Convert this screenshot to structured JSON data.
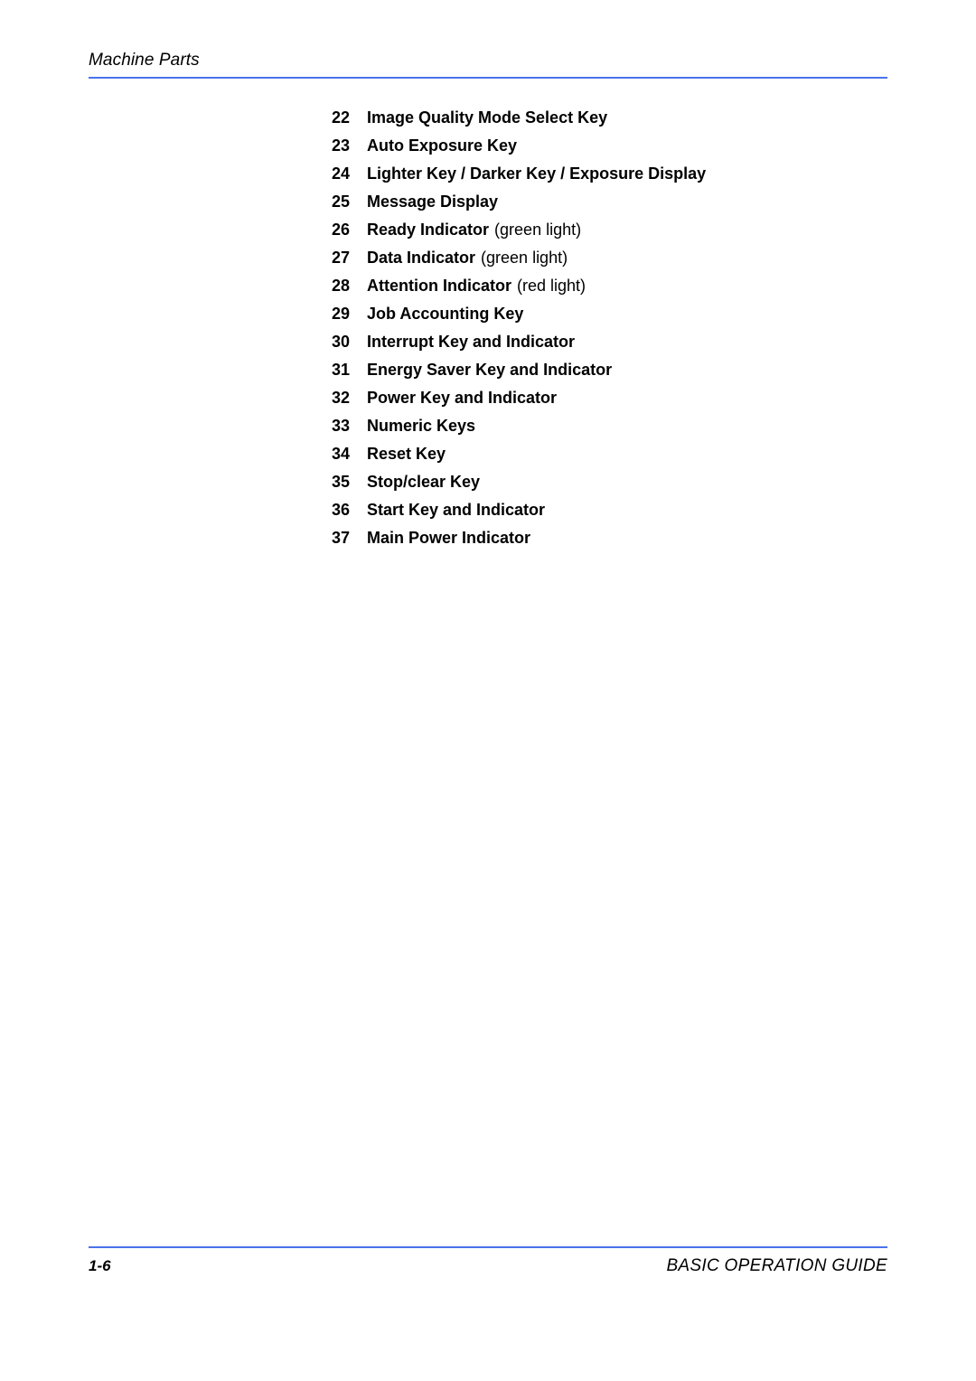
{
  "header": {
    "title": "Machine Parts",
    "rule_color": "#4a72e8"
  },
  "list": {
    "items": [
      {
        "num": "22",
        "label": "Image Quality Mode Select Key",
        "note": ""
      },
      {
        "num": "23",
        "label": "Auto Exposure Key",
        "note": ""
      },
      {
        "num": "24",
        "label": "Lighter Key / Darker Key / Exposure Display",
        "note": ""
      },
      {
        "num": "25",
        "label": "Message Display",
        "note": ""
      },
      {
        "num": "26",
        "label": "Ready Indicator",
        "note": "(green light)"
      },
      {
        "num": "27",
        "label": "Data Indicator",
        "note": "(green light)"
      },
      {
        "num": "28",
        "label": "Attention Indicator",
        "note": "(red light)"
      },
      {
        "num": "29",
        "label": "Job Accounting Key",
        "note": ""
      },
      {
        "num": "30",
        "label": "Interrupt Key and Indicator",
        "note": ""
      },
      {
        "num": "31",
        "label": "Energy Saver Key and Indicator",
        "note": ""
      },
      {
        "num": "32",
        "label": "Power Key and Indicator",
        "note": ""
      },
      {
        "num": "33",
        "label": "Numeric Keys",
        "note": ""
      },
      {
        "num": "34",
        "label": "Reset Key",
        "note": ""
      },
      {
        "num": "35",
        "label": "Stop/clear Key",
        "note": ""
      },
      {
        "num": "36",
        "label": "Start Key and Indicator",
        "note": ""
      },
      {
        "num": "37",
        "label": "Main Power Indicator",
        "note": ""
      }
    ]
  },
  "footer": {
    "page_number": "1-6",
    "guide_title": "BASIC OPERATION GUIDE",
    "rule_color": "#4a72e8"
  }
}
